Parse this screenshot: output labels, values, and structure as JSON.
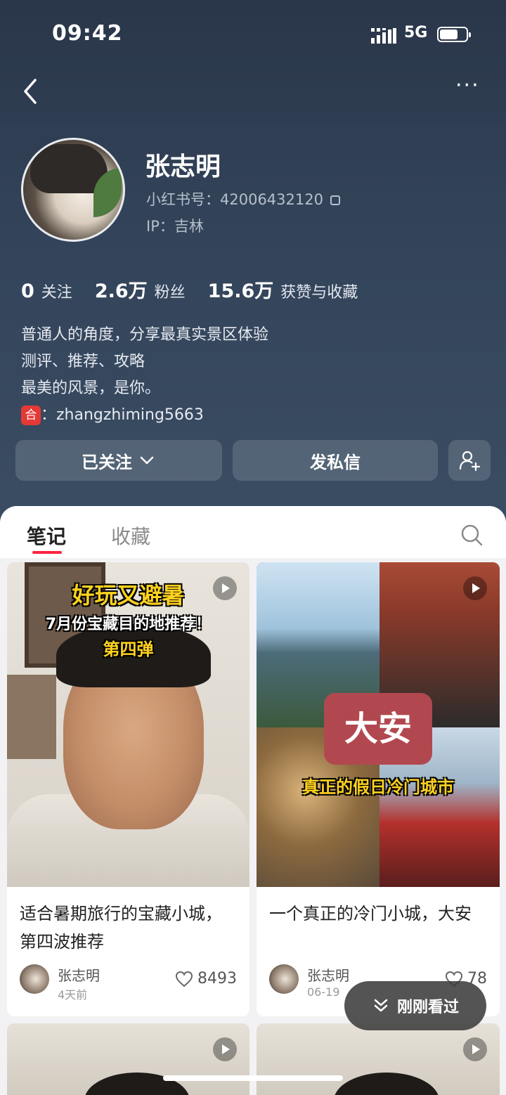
{
  "status_bar": {
    "time": "09:42",
    "network": "5G",
    "battery_level": 0.7
  },
  "profile": {
    "name": "张志明",
    "red_id": "小红书号：42006432120",
    "ip": "IP：吉林",
    "stats": [
      {
        "value": "0",
        "label": "关注"
      },
      {
        "value": "2.6万",
        "label": "粉丝"
      },
      {
        "value": "15.6万",
        "label": "获赞与收藏"
      }
    ],
    "bio_lines": [
      "普通人的角度，分享最真实景区体验",
      "测评、推荐、攻略",
      "最美的风景，是你。"
    ],
    "contact_tag": "合",
    "contact": "：zhangzhiming5663"
  },
  "actions": {
    "follow": "已关注",
    "message": "发私信"
  },
  "tabs": [
    {
      "label": "笔记"
    },
    {
      "label": "收藏"
    }
  ],
  "notes": [
    {
      "overlay_lines": [
        "好玩又避暑",
        "7月份宝藏目的地推荐！",
        "第四弹"
      ],
      "title": "适合暑期旅行的宝藏小城，第四波推荐",
      "author": "张志明",
      "time": "4天前",
      "likes": "8493"
    },
    {
      "overlay_badge": "大安",
      "overlay_caption": "真正的假日冷门城市",
      "title": "一个真正的冷门小城，大安",
      "author": "张志明",
      "time": "06-19",
      "likes": "78"
    }
  ],
  "recent_button": "刚刚看过",
  "icons": [
    "back-icon",
    "more-icon",
    "copy-icon",
    "chevron-down-icon",
    "add-friend-icon",
    "search-icon",
    "play-icon",
    "heart-icon",
    "double-chevron-down-icon"
  ],
  "colors": {
    "accent": "#ff2442",
    "header_bg": "#33445a"
  }
}
